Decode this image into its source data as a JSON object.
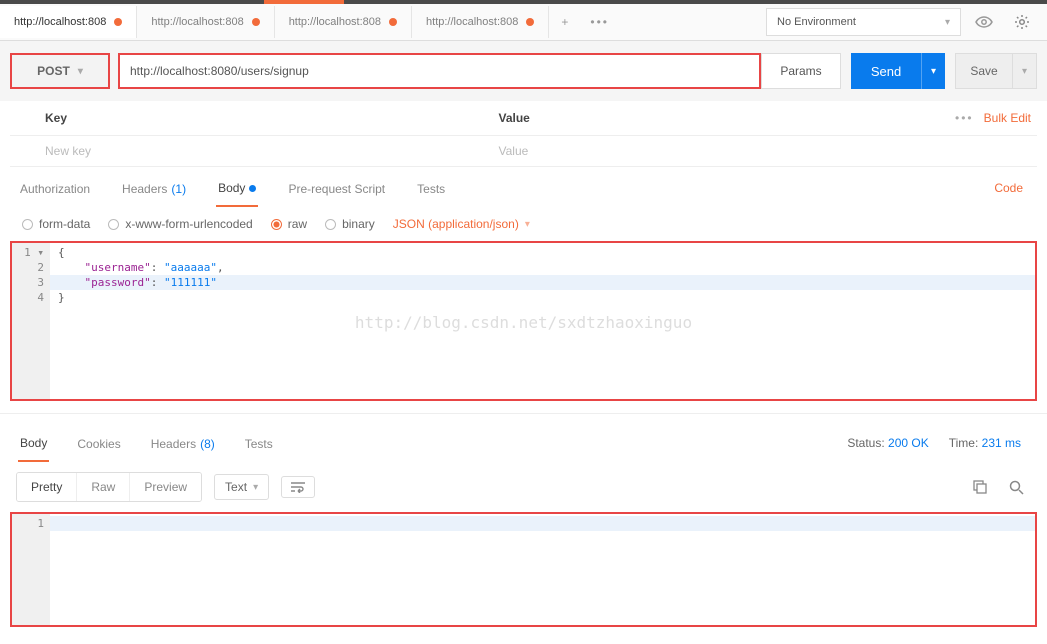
{
  "tabs": [
    {
      "label": "http://localhost:808",
      "active": true
    },
    {
      "label": "http://localhost:808",
      "active": false
    },
    {
      "label": "http://localhost:808",
      "active": false
    },
    {
      "label": "http://localhost:808",
      "active": false
    }
  ],
  "env": {
    "selected": "No Environment"
  },
  "request": {
    "method": "POST",
    "url": "http://localhost:8080/users/signup",
    "params_label": "Params",
    "send_label": "Send",
    "save_label": "Save"
  },
  "kv": {
    "key_header": "Key",
    "value_header": "Value",
    "bulk_edit": "Bulk Edit",
    "key_placeholder": "New key",
    "value_placeholder": "Value"
  },
  "subtabs": {
    "auth": "Authorization",
    "headers": "Headers",
    "headers_count": "(1)",
    "body": "Body",
    "prereq": "Pre-request Script",
    "tests": "Tests",
    "code": "Code"
  },
  "body_opts": {
    "formdata": "form-data",
    "urlencoded": "x-www-form-urlencoded",
    "raw": "raw",
    "binary": "binary",
    "content_type": "JSON (application/json)"
  },
  "editor": {
    "lines": [
      "1 ▾",
      "2",
      "3",
      "4"
    ],
    "l1": "{",
    "l2_key": "\"username\"",
    "l2_val": "\"aaaaaa\"",
    "l3_key": "\"password\"",
    "l3_val": "\"111111\"",
    "l4": "}"
  },
  "watermark": "http://blog.csdn.net/sxdtzhaoxinguo",
  "response": {
    "tabs": {
      "body": "Body",
      "cookies": "Cookies",
      "headers": "Headers",
      "headers_count": "(8)",
      "tests": "Tests"
    },
    "status_label": "Status:",
    "status_value": "200 OK",
    "time_label": "Time:",
    "time_value": "231 ms",
    "pretty": "Pretty",
    "raw": "Raw",
    "preview": "Preview",
    "format": "Text",
    "line1": "1"
  }
}
